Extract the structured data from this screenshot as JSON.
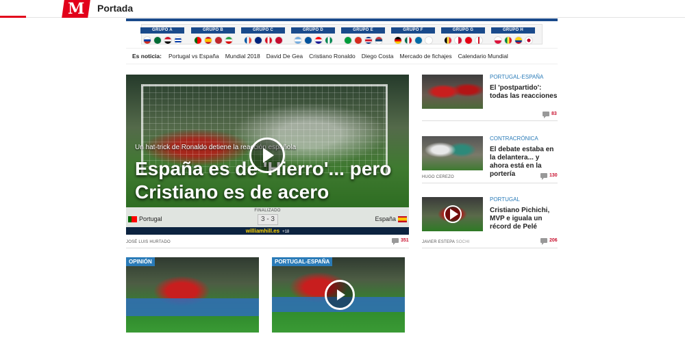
{
  "header": {
    "logo_letter": "M",
    "section_title": "Portada"
  },
  "groups": [
    {
      "name": "GRUPO A",
      "flags": [
        "ru",
        "sa",
        "eg",
        "uy"
      ]
    },
    {
      "name": "GRUPO B",
      "flags": [
        "pt",
        "es",
        "ma",
        "ir"
      ]
    },
    {
      "name": "GRUPO C",
      "flags": [
        "fr",
        "au",
        "pe",
        "dk"
      ]
    },
    {
      "name": "GRUPO D",
      "flags": [
        "ar",
        "is",
        "hr",
        "ng"
      ]
    },
    {
      "name": "GRUPO E",
      "flags": [
        "br",
        "ch",
        "cr",
        "rs"
      ]
    },
    {
      "name": "GRUPO F",
      "flags": [
        "de",
        "mx",
        "se",
        "kr"
      ]
    },
    {
      "name": "GRUPO G",
      "flags": [
        "be",
        "pa",
        "tn",
        "en"
      ]
    },
    {
      "name": "GRUPO H",
      "flags": [
        "pl",
        "sn",
        "co",
        "jp"
      ]
    }
  ],
  "trending": {
    "label": "Es noticia:",
    "items": [
      "Portugal vs España",
      "Mundial 2018",
      "David De Gea",
      "Cristiano Ronaldo",
      "Diego Costa",
      "Mercado de fichajes",
      "Calendario Mundial"
    ]
  },
  "hero": {
    "subtitle": "Un hat-trick de Ronaldo detiene la reacción española",
    "headline": "España es de 'Hierro'... pero Cristiano es de acero",
    "status": "FINALIZADO",
    "score": "3 - 3",
    "home_team": "Portugal",
    "away_team": "España",
    "sponsor": "williamhill.es",
    "sponsor_age": "+18",
    "byline": "JOSÉ LUIS HURTADO",
    "comments": "351"
  },
  "sidebar": [
    {
      "category": "PORTUGAL-ESPAÑA",
      "title": "El 'postpartido': todas las reacciones",
      "byline": "",
      "comments": "83"
    },
    {
      "category": "CONTRACRÓNICA",
      "title": "El debate estaba en la delantera... y ahora está en la portería",
      "byline": "HUGO CEREZO",
      "comments": "130"
    },
    {
      "category": "PORTUGAL",
      "title": "Cristiano Pichichi, MVP e iguala un récord de Pelé",
      "byline": "JAVIER ESTEPA",
      "byline_extra": "SOCHI",
      "comments": "206"
    }
  ],
  "cards": [
    {
      "tag": "OPINIÓN"
    },
    {
      "tag": "PORTUGAL-ESPAÑA"
    }
  ],
  "colors": {
    "brand_red": "#e2001a",
    "group_blue": "#1a4a8b",
    "link_blue": "#2a7bb8",
    "comment_red": "#c8102e"
  }
}
